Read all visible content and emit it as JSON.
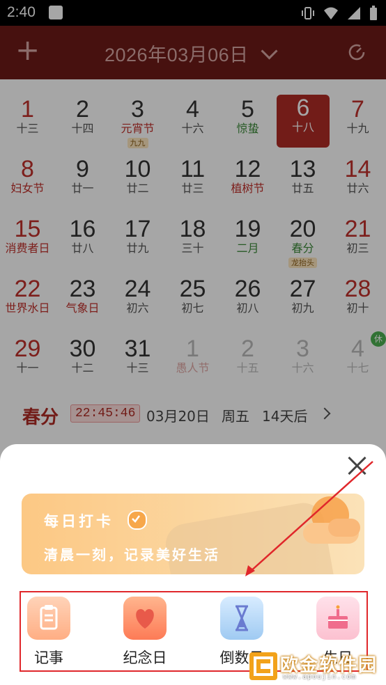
{
  "status_bar": {
    "time": "2:40"
  },
  "app_bar": {
    "add_label": "+",
    "date_title": "2026年03月06日"
  },
  "calendar": {
    "weeks": [
      [
        {
          "day": "1",
          "lunar": "十三",
          "red": true
        },
        {
          "day": "2",
          "lunar": "十四"
        },
        {
          "day": "3",
          "lunar": "元宵节",
          "lunar_style": "red",
          "tag": "九九"
        },
        {
          "day": "4",
          "lunar": "十六"
        },
        {
          "day": "5",
          "lunar": "惊蛰",
          "lunar_style": "green"
        },
        {
          "day": "6",
          "lunar": "十八",
          "selected": true
        },
        {
          "day": "7",
          "lunar": "十九",
          "red": true
        }
      ],
      [
        {
          "day": "8",
          "lunar": "妇女节",
          "red": true,
          "lunar_style": "red"
        },
        {
          "day": "9",
          "lunar": "廿一"
        },
        {
          "day": "10",
          "lunar": "廿二"
        },
        {
          "day": "11",
          "lunar": "廿三"
        },
        {
          "day": "12",
          "lunar": "植树节",
          "lunar_style": "red"
        },
        {
          "day": "13",
          "lunar": "廿五"
        },
        {
          "day": "14",
          "lunar": "廿六",
          "red": true
        }
      ],
      [
        {
          "day": "15",
          "lunar": "消费者日",
          "red": true,
          "lunar_style": "red"
        },
        {
          "day": "16",
          "lunar": "廿八"
        },
        {
          "day": "17",
          "lunar": "廿九"
        },
        {
          "day": "18",
          "lunar": "三十"
        },
        {
          "day": "19",
          "lunar": "二月",
          "lunar_style": "green"
        },
        {
          "day": "20",
          "lunar": "春分",
          "lunar_style": "green",
          "tag": "龙抬头"
        },
        {
          "day": "21",
          "lunar": "初三",
          "red": true
        }
      ],
      [
        {
          "day": "22",
          "lunar": "世界水日",
          "red": true,
          "lunar_style": "red"
        },
        {
          "day": "23",
          "lunar": "气象日",
          "lunar_style": "red"
        },
        {
          "day": "24",
          "lunar": "初六"
        },
        {
          "day": "25",
          "lunar": "初七"
        },
        {
          "day": "26",
          "lunar": "初八"
        },
        {
          "day": "27",
          "lunar": "初九"
        },
        {
          "day": "28",
          "lunar": "初十",
          "red": true
        }
      ],
      [
        {
          "day": "29",
          "lunar": "十一",
          "red": true
        },
        {
          "day": "30",
          "lunar": "十二"
        },
        {
          "day": "31",
          "lunar": "十三"
        },
        {
          "day": "1",
          "lunar": "愚人节",
          "faded": true,
          "lunar_style": "red"
        },
        {
          "day": "2",
          "lunar": "十五",
          "faded": true
        },
        {
          "day": "3",
          "lunar": "十六",
          "faded": true
        },
        {
          "day": "4",
          "lunar": "十七",
          "faded": true,
          "red": true,
          "rest": "休"
        }
      ]
    ]
  },
  "solar_term": {
    "name": "春分",
    "countdown": "22:45:46",
    "date": "03月20日",
    "weekday": "周五",
    "days_left": "14天后"
  },
  "sheet": {
    "banner_title": "每日打卡",
    "banner_subtitle": "清晨一刻，记录美好生活",
    "tools": [
      {
        "label": "记事",
        "icon": "clipboard-icon"
      },
      {
        "label": "纪念日",
        "icon": "heart-icon"
      },
      {
        "label": "倒数日",
        "icon": "hourglass-icon"
      },
      {
        "label": "生日",
        "icon": "cake-icon"
      }
    ]
  },
  "watermark": {
    "text": "欧金软件园",
    "url": "www.apoujin.com"
  },
  "colors": {
    "brand_red": "#b02b25",
    "highlight_border": "#e0272b"
  }
}
